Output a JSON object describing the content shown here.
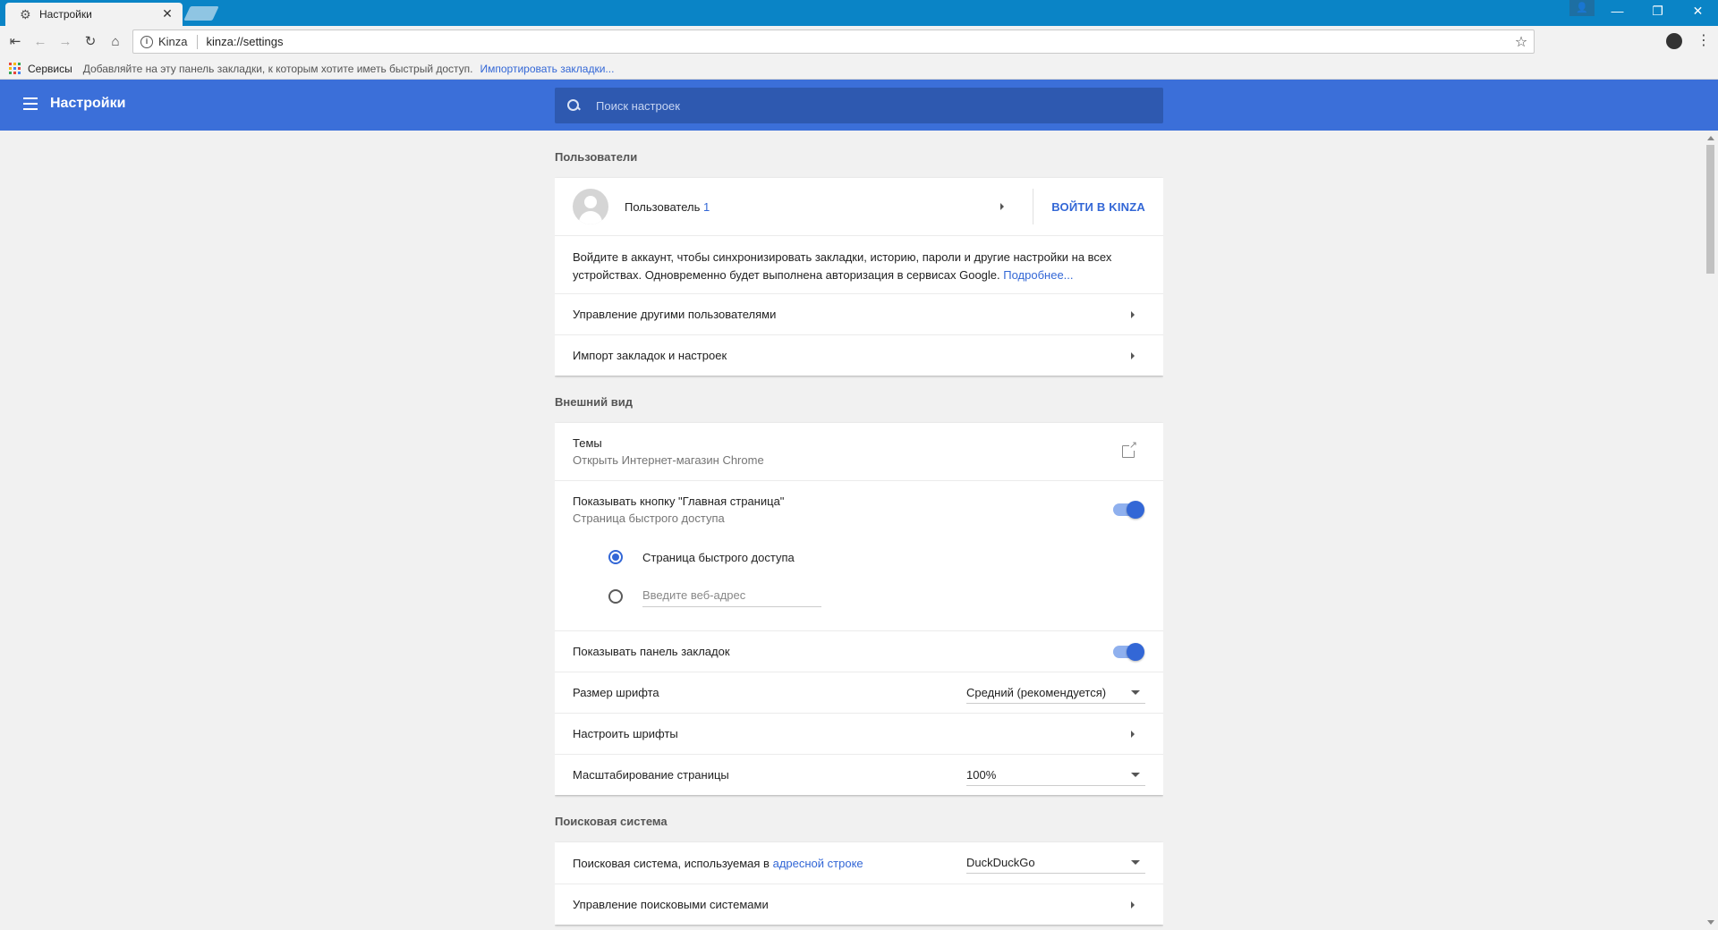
{
  "browser": {
    "tab_title": "Настройки",
    "site_label": "Kinza",
    "url": "kinza://settings"
  },
  "bookmarks_bar": {
    "services": "Сервисы",
    "hint": "Добавляйте на эту панель закладки, к которым хотите иметь быстрый доступ.",
    "import_link": "Импортировать закладки..."
  },
  "header": {
    "title": "Настройки",
    "search_placeholder": "Поиск настроек"
  },
  "users": {
    "section_title": "Пользователи",
    "user_name": "Пользователь",
    "user_number": "1",
    "signin": "ВОЙТИ В KINZA",
    "description": "Войдите в аккаунт, чтобы синхронизировать закладки, историю, пароли и другие настройки на всех устройствах. Одновременно будет выполнена авторизация в сервисах Google.",
    "more_link": "Подробнее...",
    "manage_users": "Управление другими пользователями",
    "import": "Импорт закладок и настроек"
  },
  "appearance": {
    "section_title": "Внешний вид",
    "themes_label": "Темы",
    "themes_sub": "Открыть Интернет-магазин Chrome",
    "home_button_label": "Показывать кнопку \"Главная страница\"",
    "home_button_sub": "Страница быстрого доступа",
    "home_button_on": true,
    "radio_quick_access": "Страница быстрого доступа",
    "radio_url_placeholder": "Введите веб-адрес",
    "bookmarks_bar_label": "Показывать панель закладок",
    "bookmarks_bar_on": true,
    "font_size_label": "Размер шрифта",
    "font_size_value": "Средний (рекомендуется)",
    "customize_fonts": "Настроить шрифты",
    "zoom_label": "Масштабирование страницы",
    "zoom_value": "100%"
  },
  "search_engine": {
    "section_title": "Поисковая система",
    "engine_label_prefix": "Поисковая система, используемая в",
    "engine_label_link": "адресной строке",
    "engine_value": "DuckDuckGo",
    "manage_engines": "Управление поисковыми системами"
  },
  "colors": {
    "accent": "#3367d6",
    "header_bg": "#3b6fd9",
    "titlebar": "#0a84c6"
  }
}
